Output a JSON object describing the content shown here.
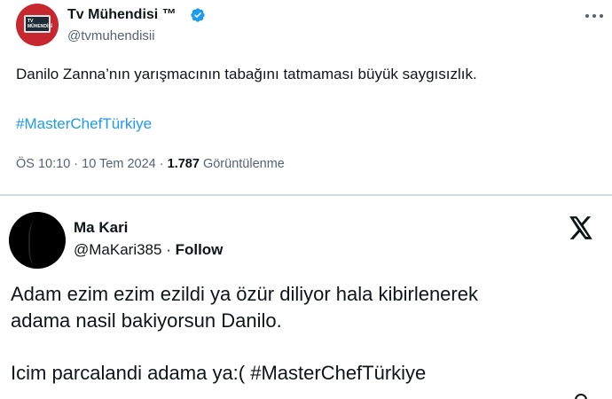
{
  "tweet": {
    "author_name": "Tv Mühendisi ™",
    "author_handle": "@tvmuhendisii",
    "avatar_label": "TV MÜHENDİSİ",
    "text": "Danilo Zanna’nın yarışmacının tabağını tatmaması büyük saygısızlık.",
    "hashtag": "#MasterChefTürkiye",
    "time": "ÖS 10:10",
    "date": "10 Tem 2024",
    "separator": " · ",
    "views_count": "1.787",
    "views_label": "Görüntülenme",
    "colors": {
      "link": "#1d9bf0",
      "secondary": "#536471",
      "verified": "#1d9bf0"
    }
  },
  "embedded_tweet": {
    "author_name": "Ma Kari",
    "author_handle": "@MaKari385",
    "separator": " · ",
    "follow_label": "Follow",
    "line1": "Adam ezim ezim ezildi ya özür diliyor hala kibirlenerek",
    "line2": "adama nasil bakiyorsun Danilo.",
    "line3": "Icim parcalandi adama ya:( #MasterChefTürkiye",
    "platform_icon": "x-logo-icon"
  }
}
